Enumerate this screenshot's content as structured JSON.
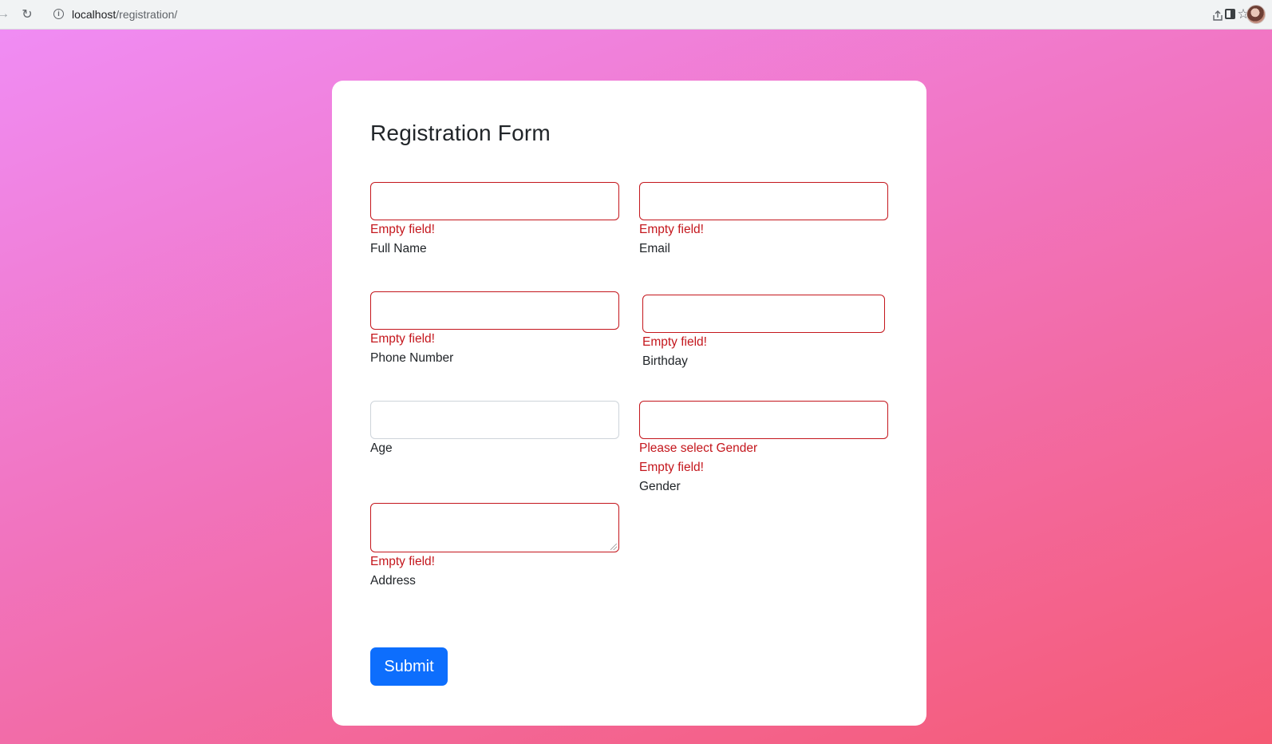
{
  "browser": {
    "url_host": "localhost",
    "url_path": "/registration/"
  },
  "form": {
    "title": "Registration Form",
    "fields": {
      "full_name": {
        "label": "Full Name",
        "error": "Empty field!"
      },
      "email": {
        "label": "Email",
        "error": "Empty field!"
      },
      "phone": {
        "label": "Phone Number",
        "error": "Empty field!"
      },
      "birthday": {
        "label": "Birthday",
        "error": "Empty field!"
      },
      "age": {
        "label": "Age"
      },
      "gender": {
        "label": "Gender",
        "error_select": "Please select Gender",
        "error": "Empty field!"
      },
      "address": {
        "label": "Address",
        "error": "Empty field!"
      }
    },
    "submit_label": "Submit"
  },
  "colors": {
    "error": "#c4161c",
    "primary": "#0d6efd",
    "gradient_start": "#f08cf4",
    "gradient_end": "#f55a73"
  }
}
